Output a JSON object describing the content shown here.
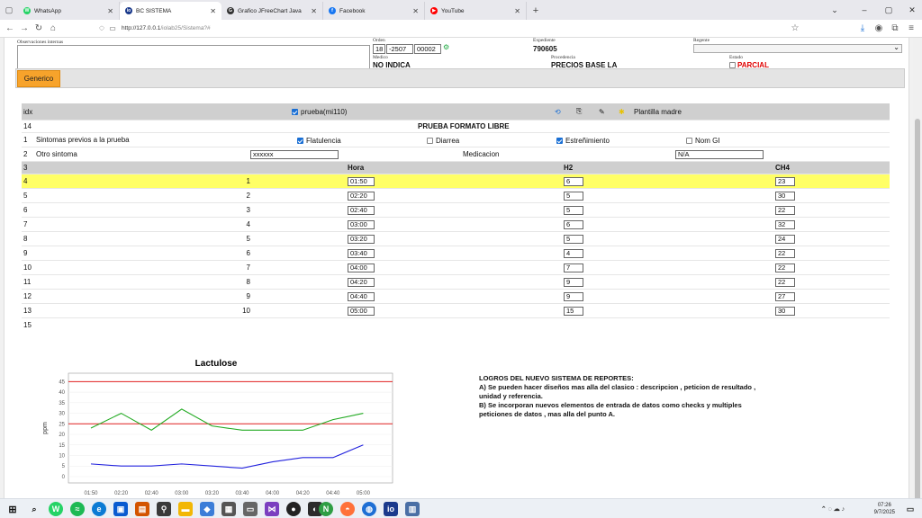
{
  "browser": {
    "tabs": [
      {
        "label": "WhatsApp",
        "color": "#25d366",
        "glyph": "W"
      },
      {
        "label": "BC SISTEMA",
        "color": "#1b3a8c",
        "glyph": "io"
      },
      {
        "label": "Grafico JFreeChart Java",
        "color": "#333",
        "glyph": "G"
      },
      {
        "label": "Facebook",
        "color": "#1877f2",
        "glyph": "f"
      },
      {
        "label": "YouTube",
        "color": "#ff0000",
        "glyph": "▶"
      }
    ],
    "active_tab": 1,
    "url_host": "http://127.0.0.1",
    "url_path": "/iolab25/Sistema?#"
  },
  "header": {
    "obs_label": "Observaciones internas",
    "orden_label": "Orden",
    "orden_a": "18",
    "orden_b": "-2507",
    "orden_c": "00002",
    "expediente_label": "Expediente",
    "expediente": "790605",
    "regente_label": "Regente",
    "medico_label": "Medico",
    "medico": "NO INDICA",
    "procedencia_label": "Procedencia",
    "procedencia": "PRECIOS BASE LA",
    "estado_label": "Estado",
    "estado": "PARCIAL",
    "estado_color": "#e00000"
  },
  "tab_label": "Generico",
  "grid": {
    "col_idx": "idx",
    "prueba_label": "prueba(mi110)",
    "plantilla_label": "Plantilla madre",
    "r14_idx": "14",
    "r14_title": "PRUEBA FORMATO LIBRE",
    "r1_idx": "1",
    "r1_label": "Sintomas previos a la prueba",
    "checks": [
      {
        "label": "Flatulencia",
        "checked": true
      },
      {
        "label": "Diarrea",
        "checked": false
      },
      {
        "label": "Estreñimiento",
        "checked": true
      },
      {
        "label": "Nom GI",
        "checked": false
      }
    ],
    "r2_idx": "2",
    "r2_label": "Otro sintoma",
    "r2_value": "xxxxxx",
    "medicacion_label": "Medicacion",
    "medicacion_value": "N/A",
    "r3_idx": "3",
    "col_hora": "Hora",
    "col_h2": "H2",
    "col_ch4": "CH4",
    "rows": [
      {
        "idx": "4",
        "n": "1",
        "hora": "01:50",
        "h2": "6",
        "ch4": "23"
      },
      {
        "idx": "5",
        "n": "2",
        "hora": "02:20",
        "h2": "5",
        "ch4": "30"
      },
      {
        "idx": "6",
        "n": "3",
        "hora": "02:40",
        "h2": "5",
        "ch4": "22"
      },
      {
        "idx": "7",
        "n": "4",
        "hora": "03:00",
        "h2": "6",
        "ch4": "32"
      },
      {
        "idx": "8",
        "n": "5",
        "hora": "03:20",
        "h2": "5",
        "ch4": "24"
      },
      {
        "idx": "9",
        "n": "6",
        "hora": "03:40",
        "h2": "4",
        "ch4": "22"
      },
      {
        "idx": "10",
        "n": "7",
        "hora": "04:00",
        "h2": "7",
        "ch4": "22"
      },
      {
        "idx": "11",
        "n": "8",
        "hora": "04:20",
        "h2": "9",
        "ch4": "22"
      },
      {
        "idx": "12",
        "n": "9",
        "hora": "04:40",
        "h2": "9",
        "ch4": "27"
      },
      {
        "idx": "13",
        "n": "10",
        "hora": "05:00",
        "h2": "15",
        "ch4": "30"
      }
    ],
    "r15_idx": "15"
  },
  "notes": {
    "title": "LOGROS DEL NUEVO SISTEMA DE REPORTES:",
    "a": "A) Se pueden hacer diseños mas alla del clasico : descripcion , peticion de resultado , unidad y referencia.",
    "b": "B) Se incorporan nuevos elementos de entrada de datos como checks y multiples peticiones de datos , mas alla del punto A."
  },
  "chart_data": {
    "type": "line",
    "title": "Lactulose",
    "xlabel": "",
    "ylabel": "ppm",
    "categories": [
      "01:50",
      "02:20",
      "02:40",
      "03:00",
      "03:20",
      "03:40",
      "04:00",
      "04:20",
      "04:40",
      "05:00"
    ],
    "series": [
      {
        "name": "H2",
        "color": "#2222dd",
        "values": [
          6,
          5,
          5,
          6,
          5,
          4,
          7,
          9,
          9,
          15
        ]
      },
      {
        "name": "CH4",
        "color": "#22aa22",
        "values": [
          23,
          30,
          22,
          32,
          24,
          22,
          22,
          22,
          27,
          30
        ]
      }
    ],
    "reference_lines": [
      {
        "y": 45,
        "color": "#e02020"
      },
      {
        "y": 25,
        "color": "#e02020"
      }
    ],
    "yticks": [
      0,
      5,
      10,
      15,
      20,
      25,
      30,
      35,
      40,
      45
    ],
    "ylim": [
      -3,
      49
    ],
    "legend": "bottom"
  },
  "taskbar": {
    "time": "07:26",
    "date": "9/7/2025"
  }
}
